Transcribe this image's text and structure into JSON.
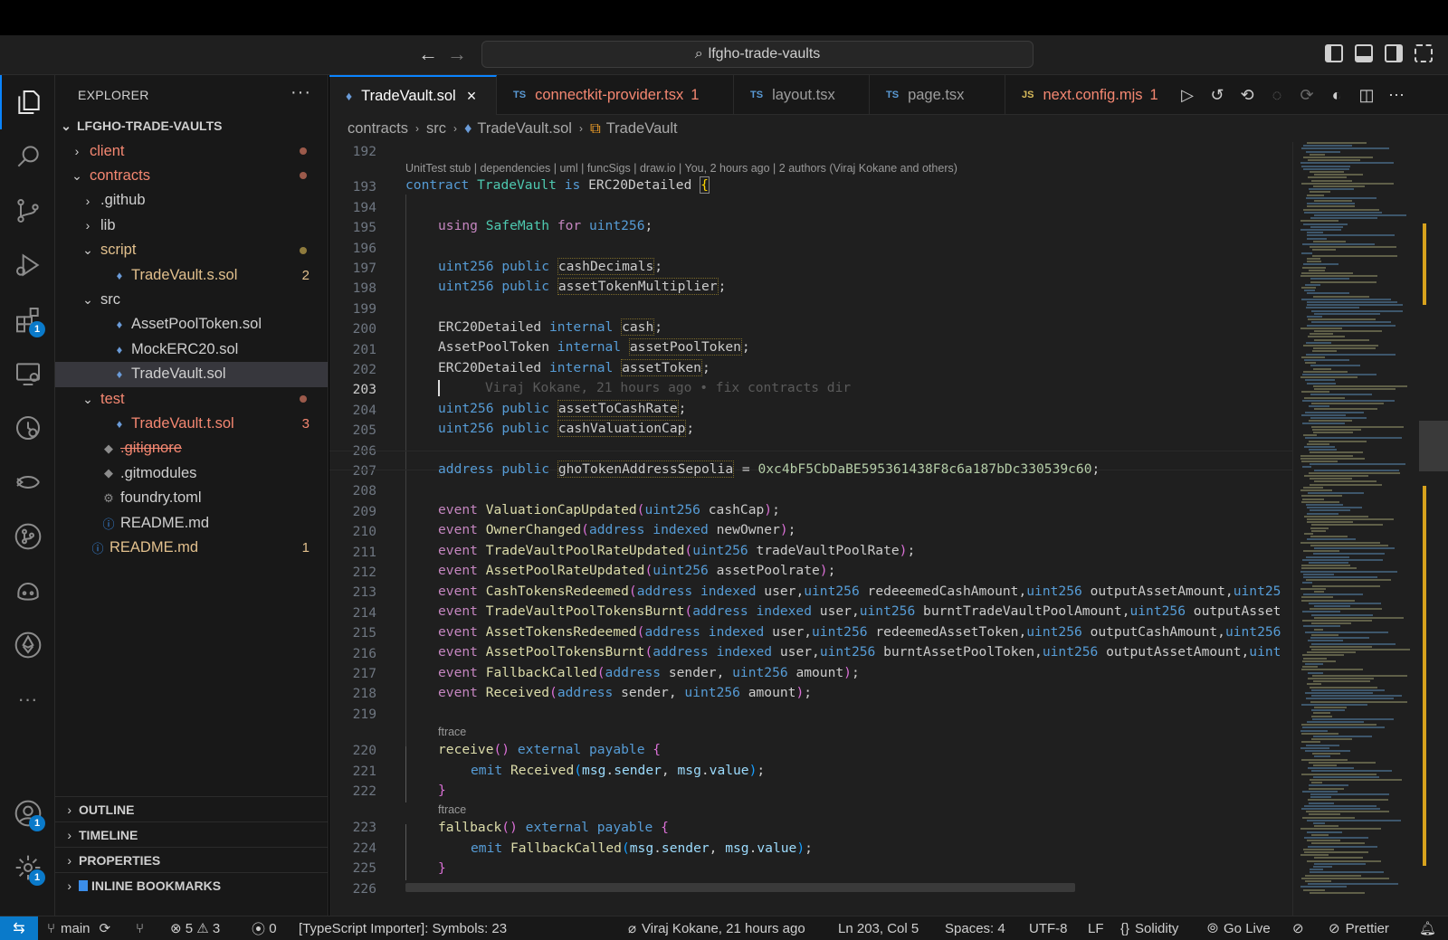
{
  "titlebar": {
    "search_text": "lfgho-trade-vaults"
  },
  "activity_bar": {
    "items": [
      {
        "name": "explorer"
      },
      {
        "name": "search"
      },
      {
        "name": "source-control"
      },
      {
        "name": "run-debug"
      },
      {
        "name": "extensions",
        "badge": "1"
      },
      {
        "name": "remote-explorer"
      },
      {
        "name": "timeline-search"
      },
      {
        "name": "foundry"
      },
      {
        "name": "git-graph"
      },
      {
        "name": "copilot"
      },
      {
        "name": "ethereum"
      },
      {
        "name": "more",
        "label": "···"
      }
    ],
    "accounts_badge": "1",
    "settings_badge": "1"
  },
  "sidebar": {
    "title": "EXPLORER",
    "more": "···",
    "root": "LFGHO-TRADE-VAULTS",
    "tree": [
      {
        "label": "client",
        "chev": "›",
        "depth": 1,
        "color": "red",
        "dot": "red"
      },
      {
        "label": "contracts",
        "chev": "⌄",
        "depth": 1,
        "color": "red",
        "dot": "red"
      },
      {
        "label": ".github",
        "chev": "›",
        "depth": 2
      },
      {
        "label": "lib",
        "chev": "›",
        "depth": 2
      },
      {
        "label": "script",
        "chev": "⌄",
        "depth": 2,
        "color": "yel",
        "dot": "yel"
      },
      {
        "label": "TradeVault.s.sol",
        "depth": 3,
        "icon": "♦",
        "color": "yel",
        "status": "2"
      },
      {
        "label": "src",
        "chev": "⌄",
        "depth": 2
      },
      {
        "label": "AssetPoolToken.sol",
        "depth": 3,
        "icon": "♦"
      },
      {
        "label": "MockERC20.sol",
        "depth": 3,
        "icon": "♦"
      },
      {
        "label": "TradeVault.sol",
        "depth": 3,
        "icon": "♦",
        "selected": true
      },
      {
        "label": "test",
        "chev": "⌄",
        "depth": 2,
        "color": "red",
        "dot": "red"
      },
      {
        "label": "TradeVault.t.sol",
        "depth": 3,
        "icon": "♦",
        "color": "red",
        "status": "3"
      },
      {
        "label": ".gitignore",
        "depth": 2,
        "icon": "◆",
        "color": "strike"
      },
      {
        "label": ".gitmodules",
        "depth": 2,
        "icon": "◆"
      },
      {
        "label": "foundry.toml",
        "depth": 2,
        "icon": "⚙"
      },
      {
        "label": "README.md",
        "depth": 2,
        "icon": "ⓘ"
      },
      {
        "label": "README.md",
        "depth": 1,
        "icon": "ⓘ",
        "color": "yel",
        "status": "1"
      }
    ],
    "sections": [
      "OUTLINE",
      "TIMELINE",
      "PROPERTIES",
      "INLINE BOOKMARKS"
    ]
  },
  "tabs": [
    {
      "label": "TradeVault.sol",
      "icon": "♦",
      "active": true,
      "close": "×"
    },
    {
      "label": "connectkit-provider.tsx",
      "icon": "TS",
      "num": "1",
      "color": "red"
    },
    {
      "label": "layout.tsx",
      "icon": "TS"
    },
    {
      "label": "page.tsx",
      "icon": "TS"
    },
    {
      "label": "next.config.mjs",
      "icon": "JS",
      "num": "1",
      "color": "red"
    }
  ],
  "breadcrumbs": [
    "contracts",
    "src",
    "TradeVault.sol",
    "TradeVault"
  ],
  "code": {
    "codelens_1": "UnitTest stub | dependencies | uml | funcSigs | draw.io | You, 2 hours ago | 2 authors (Viraj Kokane and others)",
    "codelens_2": "ftrace",
    "codelens_3": "ftrace",
    "blame": "Viraj Kokane, 21 hours ago • fix contracts dir",
    "line_numbers": [
      "192",
      "193",
      "194",
      "195",
      "196",
      "197",
      "198",
      "199",
      "200",
      "201",
      "202",
      "203",
      "204",
      "205",
      "206",
      "207",
      "208",
      "209",
      "210",
      "211",
      "212",
      "213",
      "214",
      "215",
      "216",
      "217",
      "218",
      "219",
      "220",
      "221",
      "222",
      "223",
      "224",
      "225",
      "226"
    ],
    "current_line": "203",
    "lines": {
      "l193": "contract TradeVault is ERC20Detailed {",
      "l195": "using SafeMath for uint256;",
      "l197": "uint256 public cashDecimals;",
      "l198": "uint256 public assetTokenMultiplier;",
      "l200": "ERC20Detailed internal cash;",
      "l201": "AssetPoolToken internal assetPoolToken;",
      "l202": "ERC20Detailed internal assetToken;",
      "l204": "uint256 public assetToCashRate;",
      "l205": "uint256 public cashValuationCap;",
      "l207": "address public ghoTokenAddressSepolia = 0xc4bF5CbDaBE595361438F8c6a187bDc330539c60;",
      "l209": "event ValuationCapUpdated(uint256 cashCap);",
      "l210": "event OwnerChanged(address indexed newOwner);",
      "l211": "event TradeVaultPoolRateUpdated(uint256 tradeVaultPoolRate);",
      "l212": "event AssetPoolRateUpdated(uint256 assetPoolrate);",
      "l213": "event CashTokensRedeemed(address indexed user,uint256 redeeemedCashAmount,uint256 outputAssetAmount,uint25",
      "l214": "event TradeVaultPoolTokensBurnt(address indexed user,uint256 burntTradeVaultPoolAmount,uint256 outputAsset",
      "l215": "event AssetTokensRedeemed(address indexed user,uint256 redeemedAssetToken,uint256 outputCashAmount,uint256",
      "l216": "event AssetPoolTokensBurnt(address indexed user,uint256 burntAssetPoolToken,uint256 outputAssetAmount,uint",
      "l217": "event FallbackCalled(address sender, uint256 amount);",
      "l218": "event Received(address sender, uint256 amount);",
      "l220": "receive() external payable {",
      "l221": "emit Received(msg.sender, msg.value);",
      "l222": "}",
      "l223": "fallback() external payable {",
      "l224": "emit FallbackCalled(msg.sender, msg.value);",
      "l225": "}"
    }
  },
  "statusbar": {
    "remote": "⇆",
    "branch": "main",
    "errors": "5",
    "warnings": "3",
    "ports": "0",
    "importer": "[TypeScript Importer]: Symbols: 23",
    "blame": "Viraj Kokane, 21 hours ago",
    "position": "Ln 203, Col 5",
    "spaces": "Spaces: 4",
    "encoding": "UTF-8",
    "eol": "LF",
    "language": "Solidity",
    "golive": "Go Live",
    "prettier": "Prettier"
  },
  "colors": {
    "accent": "#0a84ff",
    "status_remote": "#0a7aca",
    "modified_red": "#f48771",
    "modified_yellow": "#e2c08d"
  }
}
